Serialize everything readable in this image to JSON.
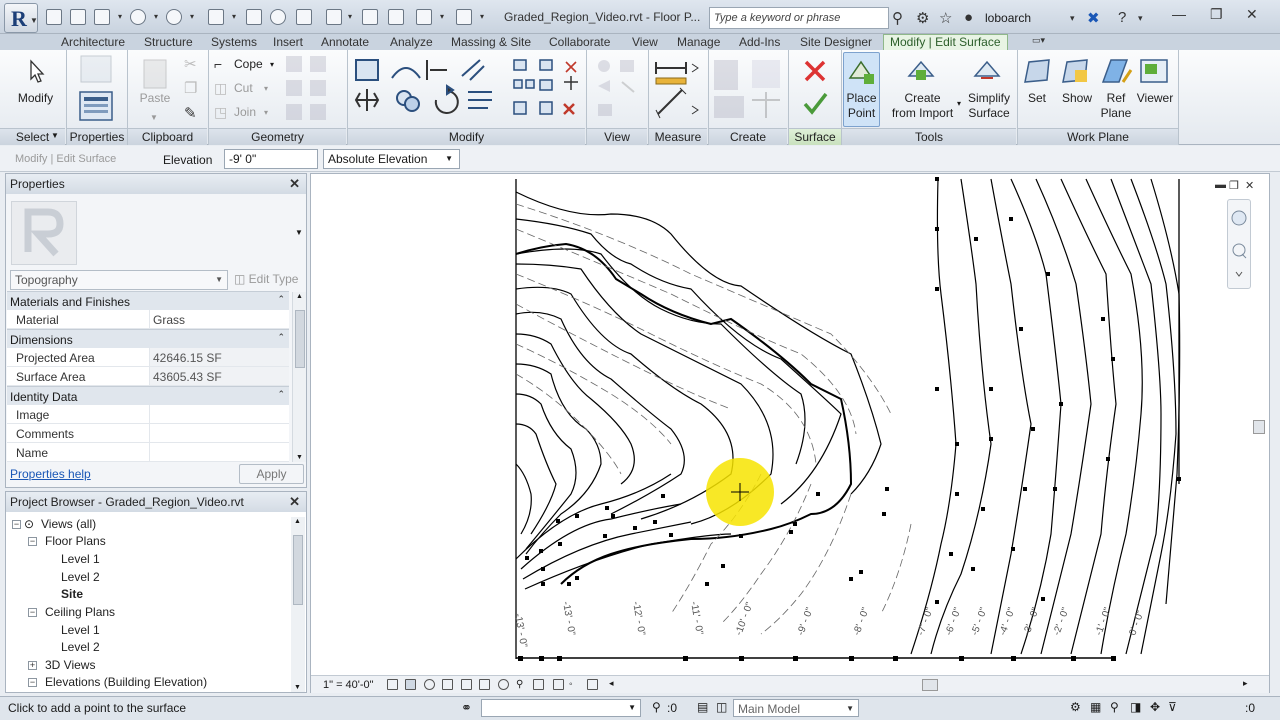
{
  "window": {
    "title": "Graded_Region_Video.rvt - Floor P...",
    "search_placeholder": "Type a keyword or phrase",
    "user": "loboarch"
  },
  "tabs": [
    "Architecture",
    "Structure",
    "Systems",
    "Insert",
    "Annotate",
    "Analyze",
    "Massing & Site",
    "Collaborate",
    "View",
    "Manage",
    "Add-Ins",
    "Site Designer",
    "Modify | Edit Surface"
  ],
  "ribbon": {
    "select": {
      "modify": "Modify",
      "title": "Select"
    },
    "properties": {
      "title": "Properties"
    },
    "clipboard": {
      "paste": "Paste",
      "title": "Clipboard"
    },
    "geometry": {
      "cope": "Cope",
      "cut": "Cut",
      "join": "Join",
      "title": "Geometry"
    },
    "modify_title": "Modify",
    "view_title": "View",
    "measure_title": "Measure",
    "create_title": "Create",
    "surface_title": "Surface",
    "tools": {
      "place_point_1": "Place",
      "place_point_2": "Point",
      "create_import_1": "Create",
      "create_import_2": "from Import",
      "simplify_1": "Simplify",
      "simplify_2": "Surface",
      "title": "Tools"
    },
    "work_plane": {
      "set": "Set",
      "show": "Show",
      "ref_1": "Ref",
      "ref_2": "Plane",
      "viewer": "Viewer",
      "title": "Work Plane"
    }
  },
  "options_bar": {
    "context": "Modify | Edit Surface",
    "elevation_label": "Elevation",
    "elevation_value": "-9'  0\"",
    "elevation_mode": "Absolute Elevation"
  },
  "properties": {
    "title": "Properties",
    "type": "Topography",
    "edit_type": "Edit Type",
    "groups": {
      "materials": "Materials and Finishes",
      "dimensions": "Dimensions",
      "identity": "Identity Data"
    },
    "rows": {
      "material": {
        "key": "Material",
        "value": "Grass"
      },
      "projected_area": {
        "key": "Projected Area",
        "value": "42646.15 SF"
      },
      "surface_area": {
        "key": "Surface Area",
        "value": "43605.43 SF"
      },
      "image": {
        "key": "Image",
        "value": ""
      },
      "comments": {
        "key": "Comments",
        "value": ""
      },
      "name": {
        "key": "Name",
        "value": ""
      }
    },
    "help": "Properties help",
    "apply": "Apply"
  },
  "browser": {
    "title": "Project Browser - Graded_Region_Video.rvt",
    "views_all": "Views (all)",
    "floor_plans": "Floor Plans",
    "fp_level1": "Level 1",
    "fp_level2": "Level 2",
    "fp_site": "Site",
    "ceiling_plans": "Ceiling Plans",
    "cp_level1": "Level 1",
    "cp_level2": "Level 2",
    "views_3d": "3D Views",
    "elevations": "Elevations (Building Elevation)"
  },
  "view_controls": {
    "scale": "1\" = 40'-0\""
  },
  "contour_labels": [
    "-13' - 0\"",
    "-12' - 0\"",
    "-11' - 0\"",
    "-10' - 0\"",
    "-9' - 0\"",
    "-8' - 0\"",
    "-7' - 0\"",
    "-6' - 0\"",
    "-5' - 0\"",
    "-4' - 0\"",
    "-3' - 0\"",
    "-2' - 0\"",
    "-1' - 0\"",
    "0' - 0\""
  ],
  "status_bar": {
    "message": "Click to add a point to the surface",
    "count_1": ":0",
    "model": "Main Model",
    "count_2": ":0"
  },
  "colors": {
    "accent_green": "#2c5e2a",
    "highlight_cursor": "#f7e400",
    "link_blue": "#1a57b6"
  }
}
